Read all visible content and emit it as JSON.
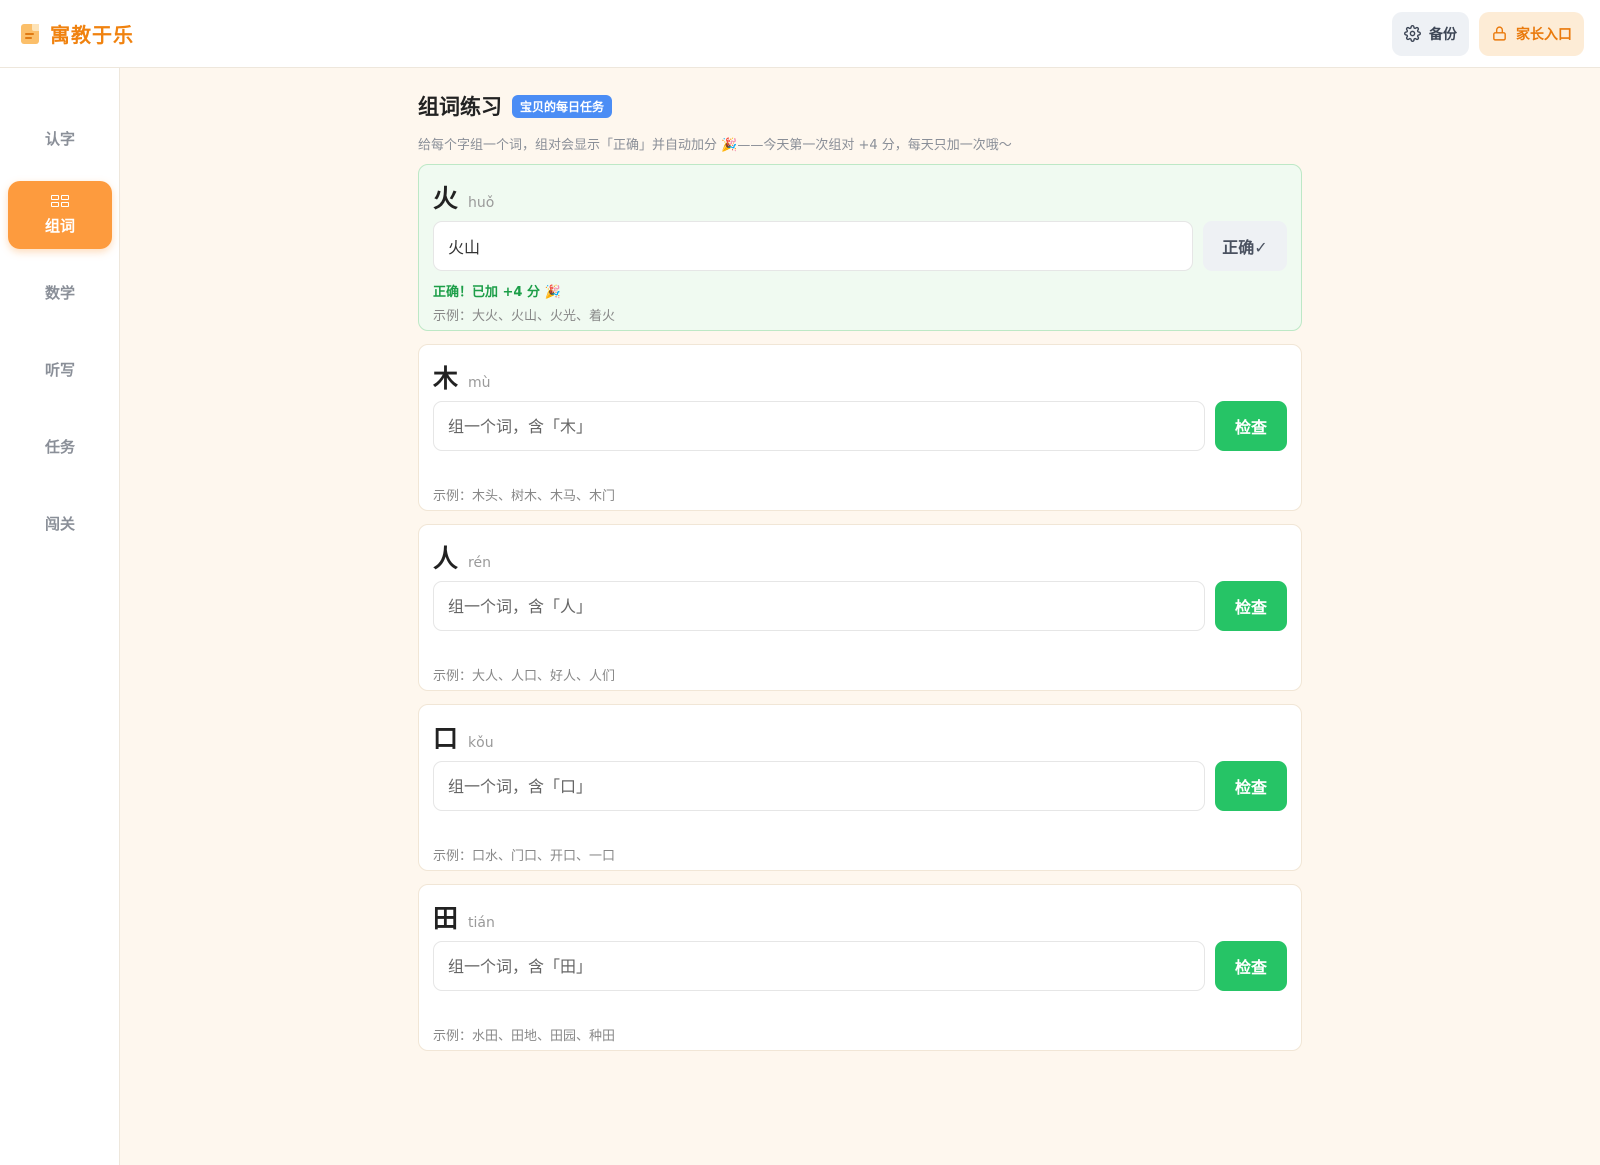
{
  "header": {
    "title": "寓教于乐",
    "backup_label": "备份",
    "parent_label": "家长入口"
  },
  "sidebar": {
    "items": [
      {
        "label": "认字"
      },
      {
        "label": "组词",
        "active": true
      },
      {
        "label": "数学"
      },
      {
        "label": "听写"
      },
      {
        "label": "任务"
      },
      {
        "label": "闯关"
      }
    ]
  },
  "main": {
    "title": "组词练习",
    "badge": "宝贝的每日任务",
    "subtitle": "给每个字组一个词，组对会显示「正确」并自动加分 🎉——今天第一次组对 +4 分，每天只加一次哦～",
    "cards": [
      {
        "char": "火",
        "pinyin": "huǒ",
        "value": "火山",
        "placeholder": "",
        "button": "正确✓",
        "feedback": "正确！已加 +4 分 🎉",
        "example": "示例：大火、火山、火光、着火"
      },
      {
        "char": "木",
        "pinyin": "mù",
        "value": "",
        "placeholder": "组一个词，含「木」",
        "button": "检查",
        "feedback": "",
        "example": "示例：木头、树木、木马、木门"
      },
      {
        "char": "人",
        "pinyin": "rén",
        "value": "",
        "placeholder": "组一个词，含「人」",
        "button": "检查",
        "feedback": "",
        "example": "示例：大人、人口、好人、人们"
      },
      {
        "char": "口",
        "pinyin": "kǒu",
        "value": "",
        "placeholder": "组一个词，含「口」",
        "button": "检查",
        "feedback": "",
        "example": "示例：口水、门口、开口、一口"
      },
      {
        "char": "田",
        "pinyin": "tián",
        "value": "",
        "placeholder": "组一个词，含「田」",
        "button": "检查",
        "feedback": "",
        "example": "示例：水田、田地、田园、种田"
      }
    ]
  },
  "colors": {
    "accent": "#fd9b3e",
    "brand_text": "#f0820f",
    "check_button": "#26c466",
    "badge": "#4b8df5",
    "success_text": "#1c9e48"
  }
}
